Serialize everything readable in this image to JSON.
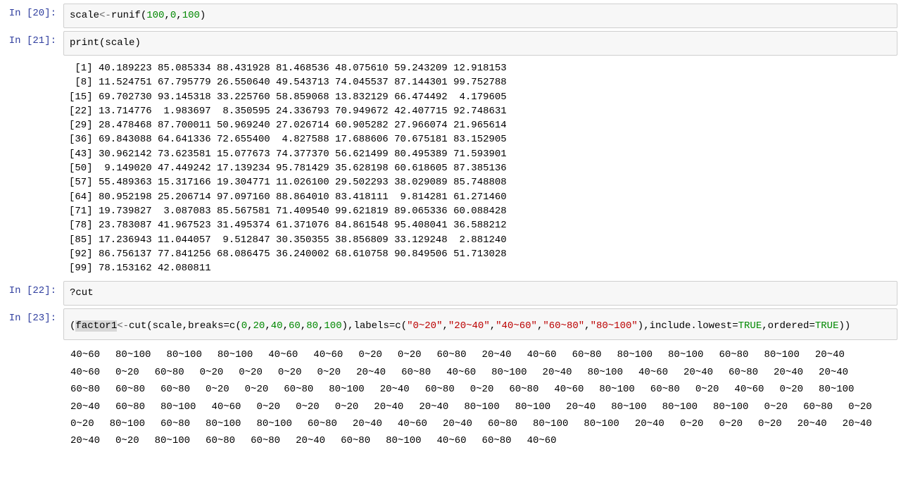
{
  "cells": {
    "c20": {
      "prompt": "In [20]:"
    },
    "c21": {
      "prompt": "In [21]:"
    },
    "c22": {
      "prompt": "In [22]:"
    },
    "c23": {
      "prompt": "In [23]:"
    }
  },
  "code20": {
    "ident": "scale",
    "arrow": "<-",
    "fn": "runif",
    "open": "(",
    "n1": "100",
    "comma1": ",",
    "n2": "0",
    "comma2": ",",
    "n3": "100",
    "close": ")"
  },
  "code21": {
    "fn": "print",
    "open": "(",
    "arg": "scale",
    "close": ")"
  },
  "out21": " [1] 40.189223 85.085334 88.431928 81.468536 48.075610 59.243209 12.918153\n [8] 11.524751 67.795779 26.550640 49.543713 74.045537 87.144301 99.752788\n[15] 69.702730 93.145318 33.225760 58.859068 13.832129 66.474492  4.179605\n[22] 13.714776  1.983697  8.350595 24.336793 70.949672 42.407715 92.748631\n[29] 28.478468 87.700011 50.969240 27.026714 60.905282 27.966074 21.965614\n[36] 69.843088 64.641336 72.655400  4.827588 17.688606 70.675181 83.152905\n[43] 30.962142 73.623581 15.077673 74.377370 56.621499 80.495389 71.593901\n[50]  9.149020 47.449242 17.139234 95.781429 35.628198 60.618605 87.385136\n[57] 55.489363 15.317166 19.304771 11.026100 29.502293 38.029089 85.748808\n[64] 80.952198 25.206714 97.097160 88.864010 83.418111  9.814281 61.271460\n[71] 19.739827  3.087083 85.567581 71.409540 99.621819 89.065336 60.088428\n[78] 23.783087 41.967523 31.495374 61.371076 84.861548 95.408041 36.588212\n[85] 17.236943 11.044057  9.512847 30.350355 38.856809 33.129248  2.881240\n[92] 86.756137 77.841256 68.086475 36.240002 68.610758 90.849506 51.713028\n[99] 78.153162 42.080811",
  "code22": {
    "q": "?",
    "fn": "cut"
  },
  "code23": {
    "open": "(",
    "ident": "factor1",
    "arrow": "<-",
    "fn1": "cut",
    "o1": "(",
    "arg_scale": "scale",
    "comma1": ",",
    "breaks_kw": "breaks",
    "eq1": "=",
    "c1": "c",
    "bo1": "(",
    "b0": "0",
    "bc1": ",",
    "b20": "20",
    "bc2": ",",
    "b40": "40",
    "bc3": ",",
    "b60": "60",
    "bc4": ",",
    "b80": "80",
    "bc5": ",",
    "b100": "100",
    "bc_close": ")",
    "comma2": ",",
    "labels_kw": "labels",
    "eq2": "=",
    "c2": "c",
    "lo1": "(",
    "l1": "\"0~20\"",
    "lc1": ",",
    "l2": "\"20~40\"",
    "lc2": ",",
    "l3": "\"40~60\"",
    "lc3": ",",
    "l4": "\"60~80\"",
    "lc4": ",",
    "l5": "\"80~100\"",
    "lc_close": ")",
    "comma3": ",",
    "incl_kw": "include.lowest",
    "eq3": "=",
    "true1": "TRUE",
    "comma4": ",",
    "ord_kw": "ordered",
    "eq4": "=",
    "true2": "TRUE",
    "c1_close": ")",
    "close": ")"
  },
  "out23_tokens": [
    "40~60",
    "80~100",
    "80~100",
    "80~100",
    "40~60",
    "40~60",
    "0~20",
    "0~20",
    "60~80",
    "20~40",
    "40~60",
    "60~80",
    "80~100",
    "80~100",
    "60~80",
    "80~100",
    "20~40",
    "40~60",
    "0~20",
    "60~80",
    "0~20",
    "0~20",
    "0~20",
    "0~20",
    "20~40",
    "60~80",
    "40~60",
    "80~100",
    "20~40",
    "80~100",
    "40~60",
    "20~40",
    "60~80",
    "20~40",
    "20~40",
    "60~80",
    "60~80",
    "60~80",
    "0~20",
    "0~20",
    "60~80",
    "80~100",
    "20~40",
    "60~80",
    "0~20",
    "60~80",
    "40~60",
    "80~100",
    "60~80",
    "0~20",
    "40~60",
    "0~20",
    "80~100",
    "20~40",
    "60~80",
    "80~100",
    "40~60",
    "0~20",
    "0~20",
    "0~20",
    "20~40",
    "20~40",
    "80~100",
    "80~100",
    "20~40",
    "80~100",
    "80~100",
    "80~100",
    "0~20",
    "60~80",
    "0~20",
    "0~20",
    "80~100",
    "60~80",
    "80~100",
    "80~100",
    "60~80",
    "20~40",
    "40~60",
    "20~40",
    "60~80",
    "80~100",
    "80~100",
    "20~40",
    "0~20",
    "0~20",
    "0~20",
    "20~40",
    "20~40",
    "20~40",
    "0~20",
    "80~100",
    "60~80",
    "60~80",
    "20~40",
    "60~80",
    "80~100",
    "40~60",
    "60~80",
    "40~60"
  ]
}
